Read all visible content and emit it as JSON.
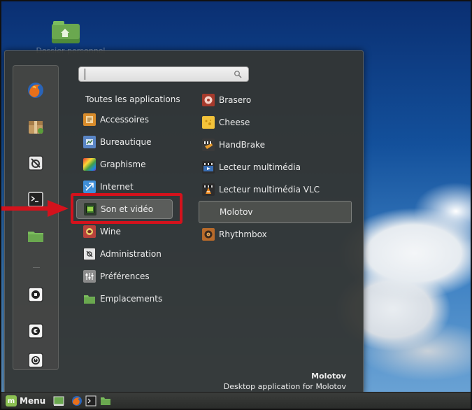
{
  "desktop": {
    "icon_label": "Dossier personnel"
  },
  "search": {
    "value": "",
    "placeholder": ""
  },
  "categories": {
    "all_label": "Toutes les applications",
    "items": [
      {
        "label": "Accessoires",
        "icon": "accessories-icon"
      },
      {
        "label": "Bureautique",
        "icon": "office-icon"
      },
      {
        "label": "Graphisme",
        "icon": "graphics-icon"
      },
      {
        "label": "Internet",
        "icon": "internet-icon"
      },
      {
        "label": "Son et vidéo",
        "icon": "sound-video-icon"
      },
      {
        "label": "Wine",
        "icon": "wine-icon"
      },
      {
        "label": "Administration",
        "icon": "administration-icon"
      },
      {
        "label": "Préférences",
        "icon": "preferences-icon"
      },
      {
        "label": "Emplacements",
        "icon": "places-folder-icon"
      }
    ],
    "selected": "Son et vidéo"
  },
  "applications": [
    {
      "label": "Brasero",
      "icon": "brasero-icon"
    },
    {
      "label": "Cheese",
      "icon": "cheese-icon"
    },
    {
      "label": "HandBrake",
      "icon": "handbrake-icon"
    },
    {
      "label": "Lecteur multimédia",
      "icon": "media-player-icon"
    },
    {
      "label": "Lecteur multimédia VLC",
      "icon": "vlc-icon"
    },
    {
      "label": "Molotov",
      "icon": ""
    },
    {
      "label": "Rhythmbox",
      "icon": "rhythmbox-icon"
    }
  ],
  "description": {
    "title": "Molotov",
    "text": "Desktop application for Molotov"
  },
  "taskbar": {
    "menu_label": "Menu"
  },
  "colors": {
    "highlight": "#d4121c",
    "menu_bg": "#343634",
    "mint_green": "#8cc152"
  }
}
